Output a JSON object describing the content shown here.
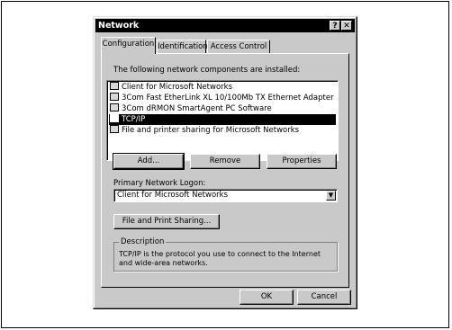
{
  "dialog": {
    "title": "Network",
    "help_button": "?",
    "close_button": "✕"
  },
  "tabs": [
    {
      "label": "Configuration",
      "active": true
    },
    {
      "label": "Identification",
      "active": false
    },
    {
      "label": "Access Control",
      "active": false
    }
  ],
  "components": {
    "label": "The following network components are installed:",
    "items": [
      {
        "label": "Client for Microsoft Networks",
        "icon": "network-client-icon",
        "selected": false
      },
      {
        "label": "3Com Fast EtherLink XL 10/100Mb TX Ethernet Adapter",
        "icon": "network-adapter-icon",
        "selected": false
      },
      {
        "label": "3Com dRMON SmartAgent PC Software",
        "icon": "protocol-icon",
        "selected": false
      },
      {
        "label": "TCP/IP",
        "icon": "protocol-icon",
        "selected": true
      },
      {
        "label": "File and printer sharing for Microsoft Networks",
        "icon": "service-icon",
        "selected": false
      }
    ]
  },
  "buttons": {
    "add": "Add...",
    "remove": "Remove",
    "properties": "Properties",
    "file_print_sharing": "File and Print Sharing...",
    "ok": "OK",
    "cancel": "Cancel"
  },
  "logon": {
    "label": "Primary Network Logon:",
    "value": "Client for Microsoft Networks"
  },
  "description": {
    "title": "Description",
    "text": "TCP/IP is the protocol you use to connect to the Internet and wide-area networks."
  }
}
